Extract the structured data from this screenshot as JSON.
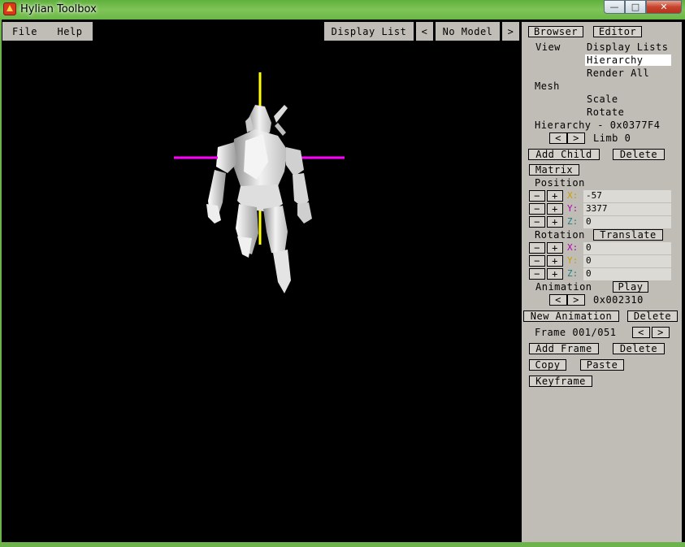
{
  "window": {
    "title": "Hylian Toolbox",
    "minimize": "—",
    "maximize": "□",
    "close": "✕"
  },
  "menu": {
    "file": "File",
    "help": "Help"
  },
  "viewport_toolbar": {
    "display_list": "Display List",
    "prev": "<",
    "model": "No Model",
    "next": ">"
  },
  "panel": {
    "tabs": {
      "browser": "Browser",
      "editor": "Editor"
    },
    "view_label": "View",
    "view_options": {
      "display_lists": "Display Lists",
      "hierarchy": "Hierarchy",
      "render_all": "Render All"
    },
    "mesh_label": "Mesh",
    "mesh_options": {
      "scale": "Scale",
      "rotate": "Rotate"
    },
    "hierarchy_title": "Hierarchy - 0x0377F4",
    "limb_prev": "<",
    "limb_next": ">",
    "limb_label": "Limb 0",
    "add_child": "Add Child",
    "delete_child": "Delete",
    "matrix": "Matrix",
    "position_label": "Position",
    "position": {
      "x_label": "X:",
      "x": "-57",
      "y_label": "Y:",
      "y": "3377",
      "z_label": "Z:",
      "z": "0"
    },
    "rotation_label": "Rotation",
    "translate": "Translate",
    "rotation": {
      "x_label": "X:",
      "x": "0",
      "y_label": "Y:",
      "y": "0",
      "z_label": "Z:",
      "z": "0"
    },
    "minus": "−",
    "plus": "+",
    "animation_label": "Animation",
    "play": "Play",
    "anim_prev": "<",
    "anim_next": ">",
    "anim_address": "0x002310",
    "new_animation": "New Animation",
    "delete_animation": "Delete",
    "frame_label": "Frame 001/051",
    "frame_prev": "<",
    "frame_next": ">",
    "add_frame": "Add Frame",
    "delete_frame": "Delete",
    "copy": "Copy",
    "paste": "Paste",
    "keyframe": "Keyframe"
  },
  "colors": {
    "axis_vertical": "#ffff00",
    "axis_horizontal": "#ff00ff",
    "panel_bg": "#c0bdb6"
  }
}
